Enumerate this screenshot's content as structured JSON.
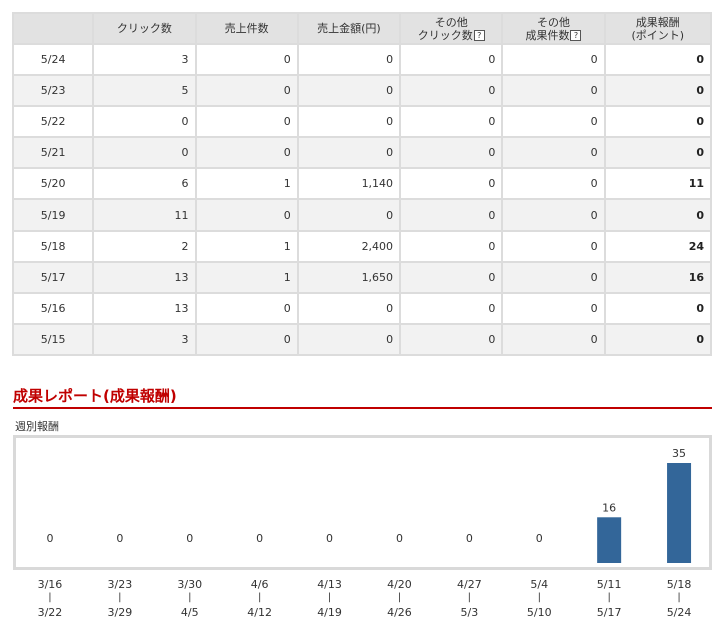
{
  "table": {
    "headers": [
      {
        "line1": "",
        "line2": "",
        "help": false
      },
      {
        "line1": "クリック数",
        "line2": "",
        "help": false
      },
      {
        "line1": "売上件数",
        "line2": "",
        "help": false
      },
      {
        "line1": "売上金額(円)",
        "line2": "",
        "help": false
      },
      {
        "line1": "その他",
        "line2": "クリック数",
        "help": true
      },
      {
        "line1": "その他",
        "line2": "成果件数",
        "help": true
      },
      {
        "line1": "成果報酬",
        "line2": "(ポイント)",
        "help": false
      }
    ],
    "help_glyph": "?",
    "rows": [
      {
        "date": "5/24",
        "clicks": "3",
        "sales": "0",
        "amount": "0",
        "other_clicks": "0",
        "other_results": "0",
        "reward": "0"
      },
      {
        "date": "5/23",
        "clicks": "5",
        "sales": "0",
        "amount": "0",
        "other_clicks": "0",
        "other_results": "0",
        "reward": "0"
      },
      {
        "date": "5/22",
        "clicks": "0",
        "sales": "0",
        "amount": "0",
        "other_clicks": "0",
        "other_results": "0",
        "reward": "0"
      },
      {
        "date": "5/21",
        "clicks": "0",
        "sales": "0",
        "amount": "0",
        "other_clicks": "0",
        "other_results": "0",
        "reward": "0"
      },
      {
        "date": "5/20",
        "clicks": "6",
        "sales": "1",
        "amount": "1,140",
        "other_clicks": "0",
        "other_results": "0",
        "reward": "11"
      },
      {
        "date": "5/19",
        "clicks": "11",
        "sales": "0",
        "amount": "0",
        "other_clicks": "0",
        "other_results": "0",
        "reward": "0"
      },
      {
        "date": "5/18",
        "clicks": "2",
        "sales": "1",
        "amount": "2,400",
        "other_clicks": "0",
        "other_results": "0",
        "reward": "24"
      },
      {
        "date": "5/17",
        "clicks": "13",
        "sales": "1",
        "amount": "1,650",
        "other_clicks": "0",
        "other_results": "0",
        "reward": "16"
      },
      {
        "date": "5/16",
        "clicks": "13",
        "sales": "0",
        "amount": "0",
        "other_clicks": "0",
        "other_results": "0",
        "reward": "0"
      },
      {
        "date": "5/15",
        "clicks": "3",
        "sales": "0",
        "amount": "0",
        "other_clicks": "0",
        "other_results": "0",
        "reward": "0"
      }
    ]
  },
  "section": {
    "title": "成果レポート(成果報酬)",
    "weekly_label": "週別報酬"
  },
  "colors": {
    "accent": "#c00000",
    "bar": "#336699",
    "header_bg": "#e2e2e2",
    "alt_row": "#f2f2f2"
  },
  "chart_data": {
    "type": "bar",
    "categories": [
      {
        "start": "3/16",
        "end": "3/22"
      },
      {
        "start": "3/23",
        "end": "3/29"
      },
      {
        "start": "3/30",
        "end": "4/5"
      },
      {
        "start": "4/6",
        "end": "4/12"
      },
      {
        "start": "4/13",
        "end": "4/19"
      },
      {
        "start": "4/20",
        "end": "4/26"
      },
      {
        "start": "4/27",
        "end": "5/3"
      },
      {
        "start": "5/4",
        "end": "5/10"
      },
      {
        "start": "5/11",
        "end": "5/17"
      },
      {
        "start": "5/18",
        "end": "5/24"
      }
    ],
    "values": [
      0,
      0,
      0,
      0,
      0,
      0,
      0,
      0,
      16,
      35
    ],
    "range_separator": "|",
    "ylim": [
      0,
      35
    ],
    "grid": false,
    "legend": "none"
  }
}
